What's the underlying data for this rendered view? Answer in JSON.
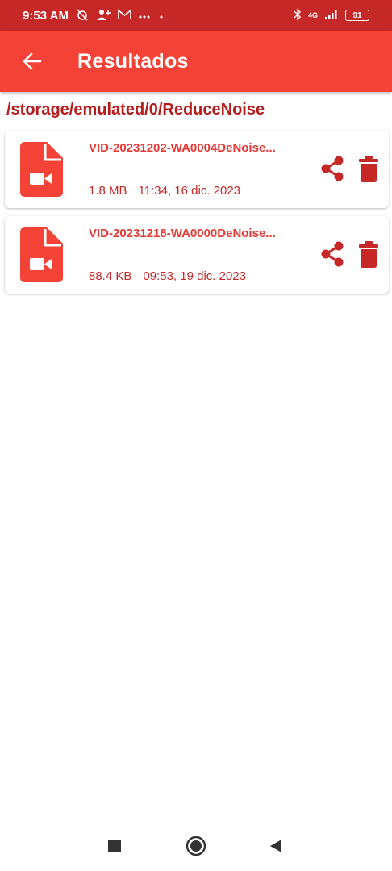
{
  "status_bar": {
    "time": "9:53 AM",
    "network": "4G",
    "battery": "91",
    "icons": [
      "alarm-off-icon",
      "person-add-icon",
      "gmail-icon",
      "more-dots-icon",
      "dot-icon",
      "bluetooth-icon",
      "signal-icon"
    ]
  },
  "app_bar": {
    "title": "Resultados",
    "back_icon": "arrow-back-icon"
  },
  "path": "/storage/emulated/0/ReduceNoise",
  "files": [
    {
      "name": "VID-20231202-WA0004DeNoise...",
      "size": "1.8 MB",
      "date": "11:34, 16 dic. 2023"
    },
    {
      "name": "VID-20231218-WA0000DeNoise...",
      "size": "88.4 KB",
      "date": "09:53, 19 dic. 2023"
    }
  ],
  "nav_bar": {
    "buttons": [
      "recents-square-icon",
      "home-circle-icon",
      "back-triangle-icon"
    ]
  },
  "colors": {
    "status_bar": "#c62828",
    "app_bar": "#f44336",
    "accent": "#e53935",
    "text_dark_red": "#b71c1c"
  }
}
